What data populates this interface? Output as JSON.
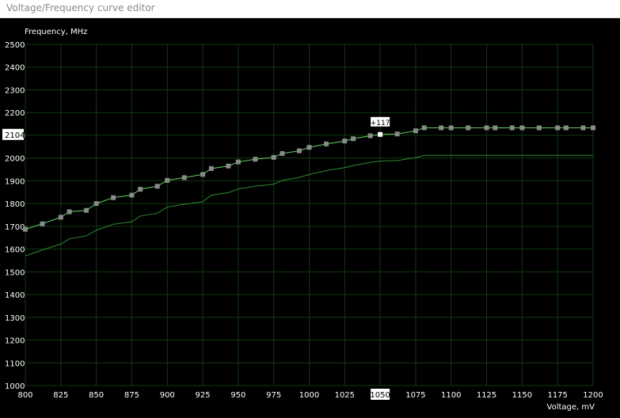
{
  "window": {
    "title": "Voltage/Frequency curve editor"
  },
  "chart_data": {
    "type": "line",
    "ylabel": "Frequency, MHz",
    "xlabel": "Voltage, mV",
    "xlim": [
      800,
      1200
    ],
    "ylim": [
      1000,
      2500
    ],
    "xticks": [
      800,
      825,
      850,
      875,
      900,
      925,
      950,
      975,
      1000,
      1025,
      1050,
      1075,
      1100,
      1125,
      1150,
      1175,
      1200
    ],
    "yticks": [
      1000,
      1100,
      1200,
      1300,
      1400,
      1500,
      1600,
      1700,
      1800,
      1900,
      2000,
      2100,
      2200,
      2300,
      2400,
      2500
    ],
    "grid": true,
    "colors": {
      "background": "#000000",
      "grid": "#0f3a0f",
      "curve": "#5fd35f",
      "base_curve": "#2e8b2e",
      "point": "#8a8a8a",
      "selected_point": "#ffffff",
      "axis_text": "#ffffff"
    },
    "series": [
      {
        "x": [
          800,
          812,
          825,
          831,
          843,
          850,
          862,
          875,
          881,
          893,
          900,
          912,
          925,
          931,
          943,
          950,
          962,
          975,
          981,
          993,
          1000,
          1012,
          1025,
          1031,
          1043,
          1050,
          1062,
          1075,
          1081,
          1093,
          1100,
          1112,
          1125,
          1131,
          1143,
          1150,
          1162,
          1175,
          1181,
          1193,
          1200
        ],
        "y": [
          1687,
          1711,
          1740,
          1764,
          1770,
          1800,
          1826,
          1837,
          1863,
          1876,
          1902,
          1914,
          1928,
          1954,
          1965,
          1983,
          1995,
          2003,
          2020,
          2032,
          2047,
          2062,
          2075,
          2085,
          2098,
          2104,
          2106,
          2120,
          2133,
          2133,
          2133,
          2133,
          2133,
          2133,
          2133,
          2133,
          2133,
          2133,
          2133,
          2133,
          2133
        ]
      },
      {
        "x": [
          800,
          812,
          825,
          831,
          843,
          850,
          862,
          875,
          881,
          893,
          900,
          912,
          925,
          931,
          943,
          950,
          962,
          975,
          981,
          993,
          1000,
          1012,
          1025,
          1031,
          1043,
          1050,
          1062,
          1075,
          1081,
          1093,
          1100,
          1112,
          1125,
          1131,
          1143,
          1150,
          1162,
          1175,
          1181,
          1193,
          1200
        ],
        "y": [
          1570,
          1596,
          1622,
          1645,
          1658,
          1683,
          1709,
          1720,
          1745,
          1758,
          1785,
          1797,
          1808,
          1837,
          1848,
          1864,
          1876,
          1885,
          1902,
          1915,
          1928,
          1945,
          1958,
          1967,
          1981,
          1987,
          1989,
          2002,
          2012,
          2012,
          2012,
          2012,
          2012,
          2012,
          2012,
          2012,
          2012,
          2012,
          2012,
          2012,
          2012
        ]
      }
    ],
    "selected_point": {
      "x": 1050,
      "y": 2104,
      "offset_label": "+117"
    },
    "selected_y_label": "2104",
    "selected_x_label": "1050"
  }
}
